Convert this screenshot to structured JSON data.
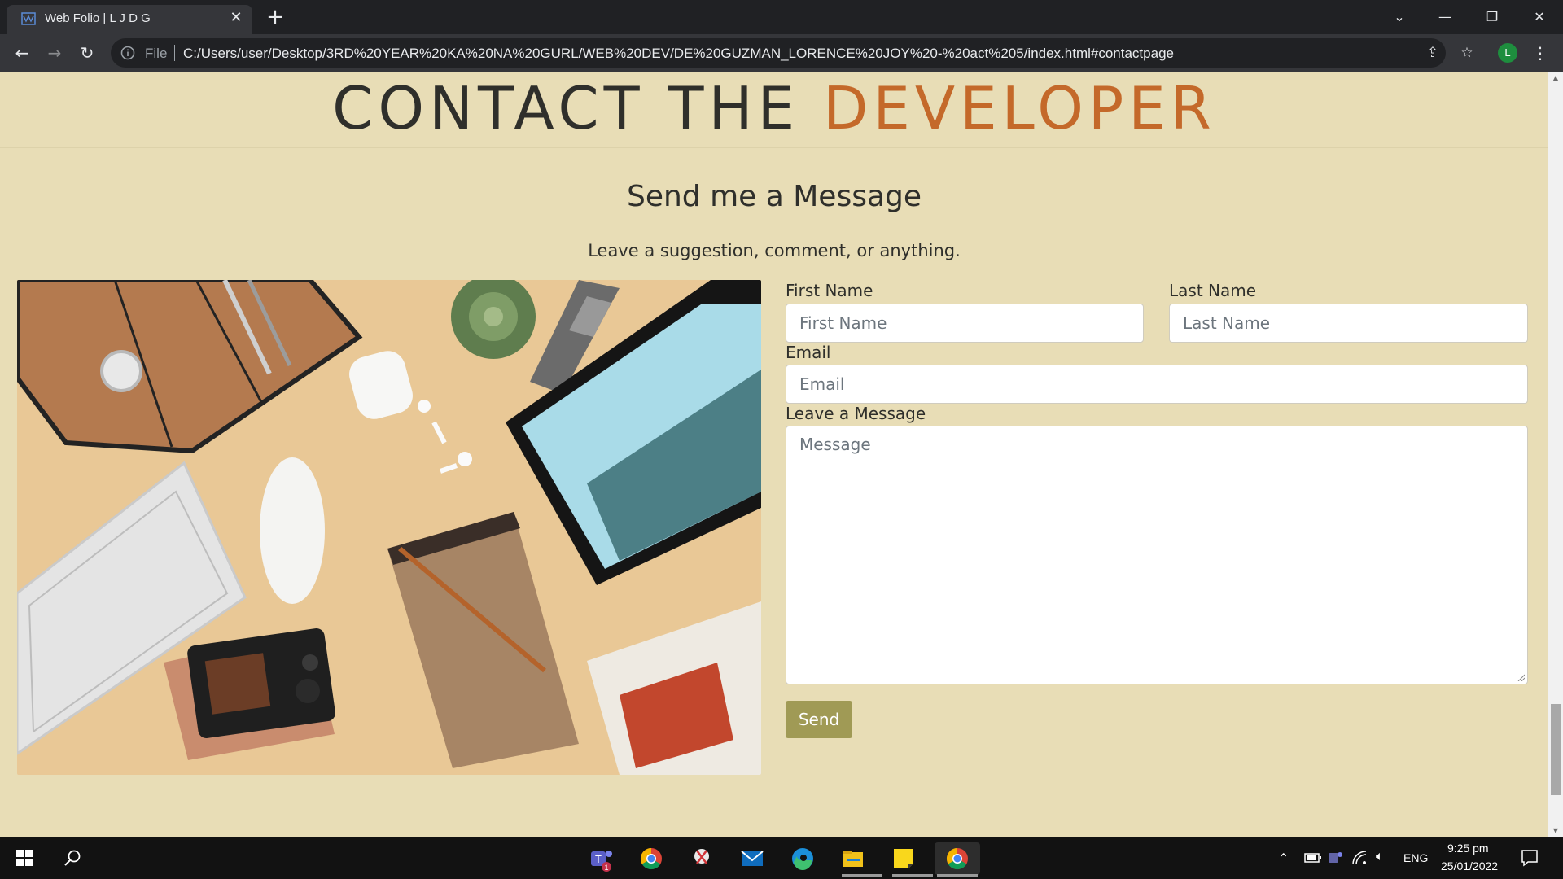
{
  "browser": {
    "tab_title": "Web Folio | L J D G",
    "file_label": "File",
    "url": "C:/Users/user/Desktop/3RD%20YEAR%20KA%20NA%20GURL/WEB%20DEV/DE%20GUZMAN_LORENCE%20JOY%20-%20act%205/index.html#contactpage",
    "profile_initial": "L"
  },
  "page": {
    "heading_main": "CONTACT THE",
    "heading_accent": "DEVELOPER",
    "sub_heading": "Send me a Message",
    "sub_text": "Leave a suggestion, comment, or anything.",
    "accent_color": "#c4692a",
    "background_color": "#e8ddb6",
    "photo_alt_icon": "desk-flatlay-photo"
  },
  "form": {
    "first_name_label": "First Name",
    "first_name_placeholder": "First Name",
    "last_name_label": "Last Name",
    "last_name_placeholder": "Last Name",
    "email_label": "Email",
    "email_placeholder": "Email",
    "message_label": "Leave a Message",
    "message_placeholder": "Message",
    "send_label": "Send",
    "send_color": "#a09a55"
  },
  "taskbar": {
    "apps": [
      "teams-icon",
      "chrome-icon",
      "snip-icon",
      "mail-icon",
      "edge-icon",
      "file-explorer-icon",
      "sticky-notes-icon",
      "chrome-active-icon"
    ],
    "teams_badge": "1",
    "language": "ENG",
    "time": "9:25 pm",
    "date": "25/01/2022"
  }
}
